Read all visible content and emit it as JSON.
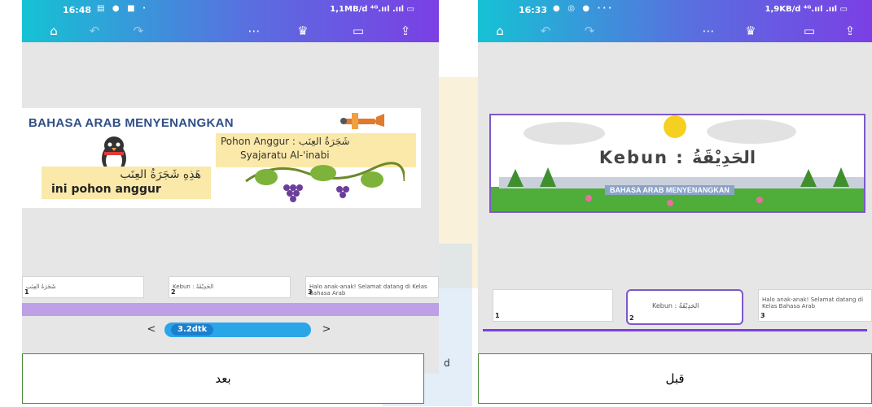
{
  "left_phone": {
    "status": {
      "time": "16:48",
      "icons": "▤ ● ■ ·",
      "right": "1,1MB/d ⁴ᴳ.ııl .ııl ▭"
    },
    "slide": {
      "title": "BAHASA ARAB MENYENANGKAN",
      "note_left_arabic": "هَذِهِ شَجَرَةُ العِنَب",
      "note_left_latin": "ini pohon anggur",
      "note_right_line1": "Pohon Anggur : شَجَرَةُ العِنَب",
      "note_right_line2": "Syajaratu Al-'inabi"
    },
    "filmstrip": [
      {
        "num": "1",
        "text": "شَجَرَةُ العِنَب"
      },
      {
        "num": "2",
        "text": "Kebun : الحَدِيْقَةُ"
      },
      {
        "num": "3",
        "text": "Halo anak-anak! Selamat datang di Kelas Bahasa Arab"
      }
    ],
    "duration": {
      "value": "3.2dtk",
      "prev": "<",
      "next": ">"
    },
    "caption": "بعد",
    "side_text": "d"
  },
  "right_phone": {
    "status": {
      "time": "16:33",
      "icons": "● ◎ ● ···",
      "right": "1,9KB/d ⁴ᴳ.ııl .ııl ▭"
    },
    "slide": {
      "title": "Kebun : الحَدِيْقَةُ",
      "banner": "BAHASA ARAB MENYENANGKAN"
    },
    "filmstrip": [
      {
        "num": "1",
        "text": ""
      },
      {
        "num": "2",
        "text": "Kebun : الحَدِيْقَةُ"
      },
      {
        "num": "3",
        "text": "Halo anak-anak! Selamat datang di Kelas Bahasa Arab"
      }
    ],
    "caption": "قبل"
  }
}
